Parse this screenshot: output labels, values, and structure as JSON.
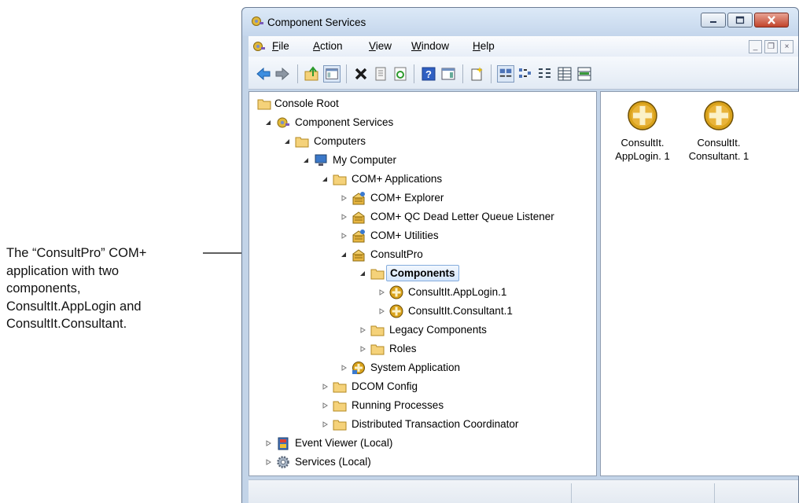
{
  "annotation": {
    "lines": [
      "The “ConsultPro” COM+",
      "application with two",
      "components,",
      "ConsultIt.AppLogin and",
      "ConsultIt.Consultant."
    ]
  },
  "window": {
    "title": "Component Services",
    "app_icon": "component-services-icon"
  },
  "menu": {
    "file": {
      "accel": "F",
      "rest": "ile"
    },
    "action": {
      "accel": "A",
      "rest": "ction"
    },
    "view": {
      "accel": "V",
      "rest": "iew"
    },
    "window": {
      "accel": "W",
      "rest": "indow"
    },
    "help": {
      "accel": "H",
      "rest": "elp"
    }
  },
  "toolbar": {
    "buttons": [
      "back-icon",
      "forward-icon",
      "up-icon",
      "show-hide-tree-icon",
      "delete-icon",
      "properties-icon",
      "refresh-icon",
      "help-icon",
      "action-pane-icon",
      "new-window-icon",
      "large-icons-icon",
      "small-icons-icon",
      "list-view-icon",
      "detail-view-icon",
      "status-view-icon"
    ]
  },
  "tree": {
    "console_root": "Console Root",
    "component_services": "Component Services",
    "computers": "Computers",
    "my_computer": "My Computer",
    "com_applications": "COM+ Applications",
    "com_explorer": "COM+ Explorer",
    "qc_dead_letter": "COM+ QC Dead Letter Queue Listener",
    "com_utilities": "COM+ Utilities",
    "consultpro": "ConsultPro",
    "components": "Components",
    "applogin": "ConsultIt.AppLogin.1",
    "consultant": "ConsultIt.Consultant.1",
    "legacy_components": "Legacy Components",
    "roles": "Roles",
    "system_application": "System Application",
    "dcom_config": "DCOM Config",
    "running_processes": "Running Processes",
    "dtc": "Distributed Transaction Coordinator",
    "event_viewer": "Event Viewer (Local)",
    "services": "Services (Local)"
  },
  "list": {
    "items": [
      {
        "line1": "ConsultIt.",
        "line2": "AppLogin. 1"
      },
      {
        "line1": "ConsultIt.",
        "line2": "Consultant. 1"
      }
    ]
  },
  "colors": {
    "selection_border": "#84acdd",
    "component_gold": "#d9a21b",
    "folder_yellow": "#f5d27a",
    "close_red": "#c1442b"
  }
}
